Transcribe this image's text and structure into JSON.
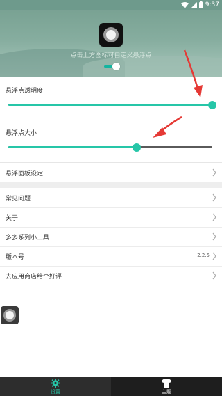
{
  "status_bar": {
    "time": "9:37",
    "icons": [
      "wifi-icon",
      "signal-icon",
      "battery-icon"
    ]
  },
  "header": {
    "hint": "点击上方图标可自定义悬浮点",
    "icon": "floating-ball-icon",
    "switch_on": true
  },
  "sliders": [
    {
      "label": "悬浮点透明度",
      "value_percent": 100
    },
    {
      "label": "悬浮点大小",
      "value_percent": 63
    }
  ],
  "panel_settings": {
    "label": "悬浮面板设定"
  },
  "menu": [
    {
      "label": "常见问题",
      "value": ""
    },
    {
      "label": "关于",
      "value": ""
    },
    {
      "label": "多多系列小工具",
      "value": ""
    },
    {
      "label": "版本号",
      "value": "2.2.5"
    },
    {
      "label": "去应用商店给个好评",
      "value": ""
    }
  ],
  "bottom_nav": [
    {
      "label": "设置",
      "icon": "gear-icon",
      "active": true
    },
    {
      "label": "主题",
      "icon": "tshirt-icon",
      "active": false
    }
  ],
  "colors": {
    "accent": "#26c6a8",
    "annotation": "#e53935",
    "nav_bg": "#2d2d2d"
  }
}
